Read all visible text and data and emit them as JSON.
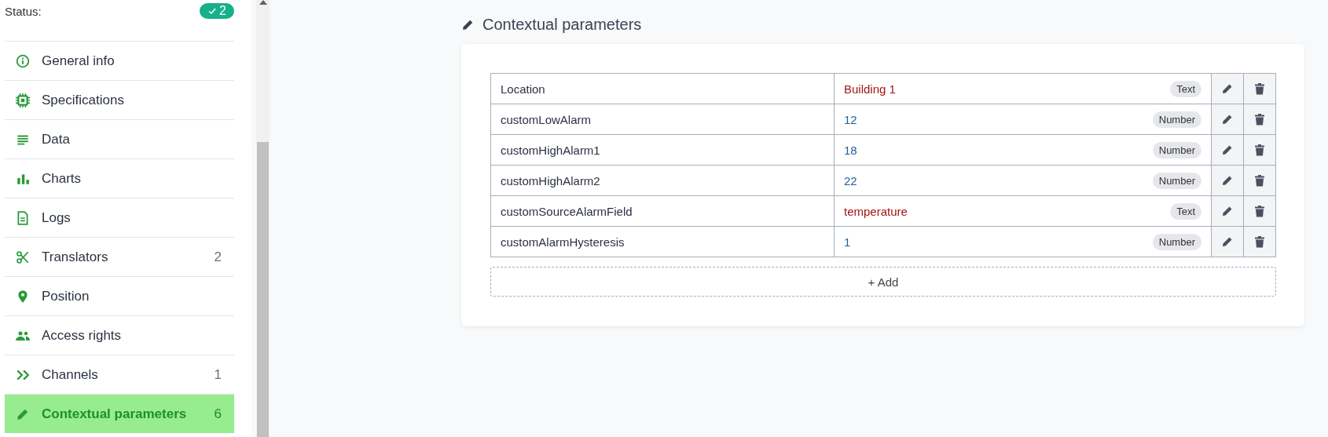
{
  "sidebar": {
    "status": {
      "label": "Status:",
      "badge": "2"
    },
    "items": [
      {
        "label": "General info",
        "selected": false
      },
      {
        "label": "Specifications",
        "selected": false
      },
      {
        "label": "Data",
        "selected": false
      },
      {
        "label": "Charts",
        "selected": false
      },
      {
        "label": "Logs",
        "selected": false
      },
      {
        "label": "Translators",
        "count": "2",
        "selected": false
      },
      {
        "label": "Position",
        "selected": false
      },
      {
        "label": "Access rights",
        "selected": false
      },
      {
        "label": "Channels",
        "count": "1",
        "selected": false
      },
      {
        "label": "Contextual parameters",
        "count": "6",
        "selected": true
      }
    ]
  },
  "main": {
    "title": "Contextual parameters",
    "parameters": [
      {
        "name": "Location",
        "value": "Building 1",
        "kind": "text",
        "type": "Text"
      },
      {
        "name": "customLowAlarm",
        "value": "12",
        "kind": "number",
        "type": "Number"
      },
      {
        "name": "customHighAlarm1",
        "value": "18",
        "kind": "number",
        "type": "Number"
      },
      {
        "name": "customHighAlarm2",
        "value": "22",
        "kind": "number",
        "type": "Number"
      },
      {
        "name": "customSourceAlarmField",
        "value": "temperature",
        "kind": "text",
        "type": "Text"
      },
      {
        "name": "customAlarmHysteresis",
        "value": "1",
        "kind": "number",
        "type": "Number"
      }
    ],
    "add_button": "+ Add"
  }
}
